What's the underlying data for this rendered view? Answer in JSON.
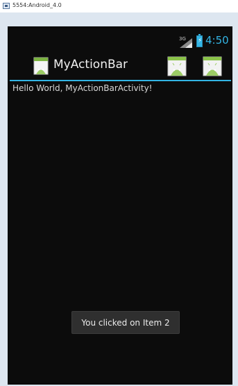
{
  "window": {
    "title": "5554:Android_4.0"
  },
  "status_bar": {
    "network_type": "3G",
    "time": "4:50"
  },
  "action_bar": {
    "title": "MyActionBar",
    "items": [
      {
        "icon": "android-icon"
      },
      {
        "icon": "android-icon"
      }
    ]
  },
  "content": {
    "text": "Hello World, MyActionBarActivity!"
  },
  "toast": {
    "message": "You clicked on Item 2"
  },
  "colors": {
    "accent": "#33b5e5",
    "screen_background": "#0c0c0c",
    "toast_background": "#2f2f2f"
  }
}
